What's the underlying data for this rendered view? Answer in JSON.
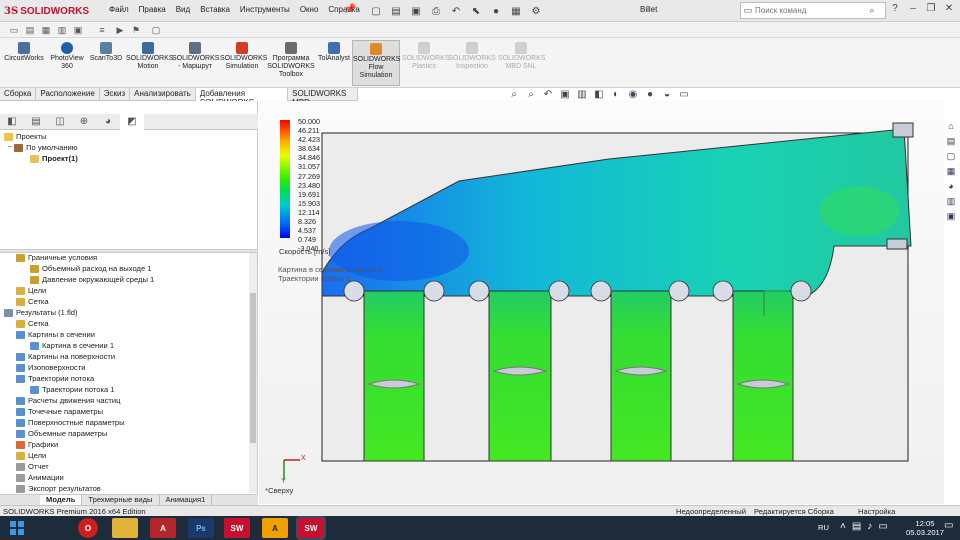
{
  "app": {
    "brand": "SOLIDWORKS",
    "document_title": "Billet"
  },
  "menu": [
    "Файл",
    "Правка",
    "Вид",
    "Вставка",
    "Инструменты",
    "Окно",
    "Справка"
  ],
  "search": {
    "placeholder": "Поиск команд"
  },
  "ribbon": [
    {
      "label": "CircuitWorks",
      "icon": "circuitworks-icon",
      "color": "#4a6fa5"
    },
    {
      "label": "PhotoView 360",
      "icon": "photoview-icon",
      "color": "#1f5fa8"
    },
    {
      "label": "ScanTo3D",
      "icon": "scanto3d-icon",
      "color": "#5a7fa0"
    },
    {
      "label": "SOLIDWORKS Motion",
      "icon": "motion-icon",
      "color": "#3c6b9e"
    },
    {
      "label": "SOLIDWORKS - Маршрут",
      "icon": "routing-icon",
      "color": "#5b6f85"
    },
    {
      "label": "SOLIDWORKS Simulation",
      "icon": "simulation-icon",
      "color": "#d23d2a"
    },
    {
      "label": "Программа SOLIDWORKS Toolbox",
      "icon": "toolbox-icon",
      "color": "#6b6b6b"
    },
    {
      "label": "TolAnalyst",
      "icon": "tolanalyst-icon",
      "color": "#3f6fb0"
    },
    {
      "label": "SOLIDWORKS Flow Simulation",
      "icon": "flow-simulation-icon",
      "color": "#e08b2a",
      "active": true
    },
    {
      "label": "SOLIDWORKS Plastics",
      "icon": "plastics-icon",
      "color": "#bbbbbb",
      "disabled": true
    },
    {
      "label": "SOLIDWORKS Inspection",
      "icon": "inspection-icon",
      "color": "#bbbbbb",
      "disabled": true
    },
    {
      "label": "SOLIDWORKS MBD SNL",
      "icon": "mbd-snl-icon",
      "color": "#bbbbbb",
      "disabled": true
    }
  ],
  "tabs": [
    "Сборка",
    "Расположение",
    "Эскиз",
    "Анализировать",
    "Добавления SOLIDWORKS",
    "SOLIDWORKS MBD"
  ],
  "tabs_selected": 4,
  "tree_top": {
    "root": "Проекты",
    "child": "По умолчанию",
    "project": "Проект(1)"
  },
  "tree_bottom": [
    {
      "label": "Граничные условия",
      "indent": 1
    },
    {
      "label": "Объемный расход на выходе 1",
      "indent": 2
    },
    {
      "label": "Давление окружающей среды 1",
      "indent": 2
    },
    {
      "label": "Цели",
      "indent": 1
    },
    {
      "label": "Сетка",
      "indent": 1
    },
    {
      "label": "Результаты (1.fld)",
      "indent": 0
    },
    {
      "label": "Сетка",
      "indent": 1
    },
    {
      "label": "Картины в сечении",
      "indent": 1
    },
    {
      "label": "Картина в сечении 1",
      "indent": 2
    },
    {
      "label": "Картины на поверхности",
      "indent": 1
    },
    {
      "label": "Изоповерхности",
      "indent": 1
    },
    {
      "label": "Траектории потока",
      "indent": 1
    },
    {
      "label": "Траектории потока 1",
      "indent": 2
    },
    {
      "label": "Расчеты движения частиц",
      "indent": 1
    },
    {
      "label": "Точечные параметры",
      "indent": 1
    },
    {
      "label": "Поверхностные параметры",
      "indent": 1
    },
    {
      "label": "Объемные параметры",
      "indent": 1
    },
    {
      "label": "Графики",
      "indent": 1
    },
    {
      "label": "Цели",
      "indent": 1
    },
    {
      "label": "Отчет",
      "indent": 1
    },
    {
      "label": "Анимации",
      "indent": 1
    },
    {
      "label": "Экспорт результатов",
      "indent": 1
    }
  ],
  "bottom_tabs": [
    "Модель",
    "Трехмерные виды",
    "Анимация1"
  ],
  "legend": {
    "ticks": [
      "50.000",
      "46.211",
      "42.423",
      "38.634",
      "34.846",
      "31.057",
      "27.269",
      "23.480",
      "19.691",
      "15.903",
      "12.114",
      "8.326",
      "4.537",
      "0.749",
      "-3.040"
    ],
    "label": "Скорость [m/s]"
  },
  "viewport_caption": [
    "Картина в сечении 1: заливка",
    "Траектории потока 1"
  ],
  "orientation": "*Сверху",
  "axes": {
    "x": "X",
    "y": "Y"
  },
  "status": {
    "edition": "SOLIDWORKS Premium 2016 x64 Edition",
    "state": "Недоопределенный",
    "editing": "Редактируется Сборка",
    "settings": "Настройка"
  },
  "taskbar": {
    "apps": [
      {
        "name": "opera-icon",
        "color": "#cc1f1f",
        "text": "O"
      },
      {
        "name": "explorer-icon",
        "color": "#e0b43b",
        "text": ""
      },
      {
        "name": "autocad-icon",
        "color": "#b3272a",
        "text": "A"
      },
      {
        "name": "photoshop-icon",
        "color": "#1b3a6b",
        "text": "Ps"
      },
      {
        "name": "solidworks-2016-icon",
        "color": "#c8102e",
        "text": "SW"
      },
      {
        "name": "archicad-icon",
        "color": "#f0a000",
        "text": "A"
      },
      {
        "name": "solidworks-2016b-icon",
        "color": "#c8102e",
        "text": "SW"
      }
    ],
    "lang": "RU",
    "time": "12:05",
    "date": "05.03.2017"
  }
}
